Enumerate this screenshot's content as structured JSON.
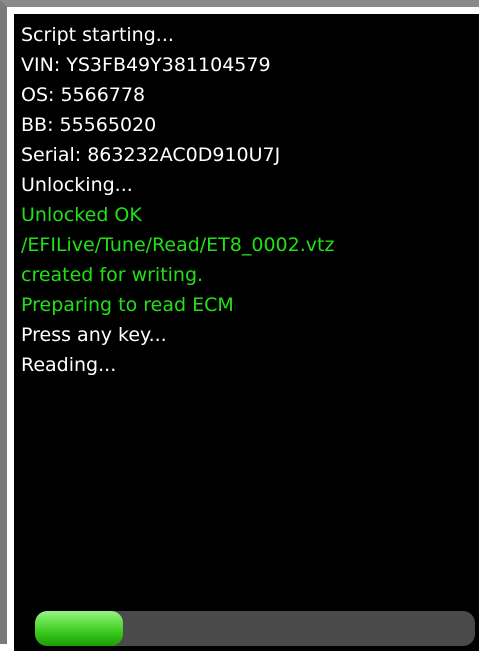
{
  "colors": {
    "white_text": "#ffffff",
    "green_text": "#22e016",
    "background": "#000000"
  },
  "log": {
    "lines": [
      {
        "text": "Script starting...",
        "color": "#ffffff"
      },
      {
        "text": "VIN: YS3FB49Y381104579",
        "color": "#ffffff"
      },
      {
        "text": "OS: 5566778",
        "color": "#ffffff"
      },
      {
        "text": "BB: 55565020",
        "color": "#ffffff"
      },
      {
        "text": "Serial: 863232AC0D910U7J",
        "color": "#ffffff"
      },
      {
        "text": "Unlocking...",
        "color": "#ffffff"
      },
      {
        "text": "Unlocked OK",
        "color": "#22e016"
      },
      {
        "text": "/EFILive/Tune/Read/ET8_0002.vtz",
        "color": "#22e016"
      },
      {
        "text": "created for writing.",
        "color": "#22e016"
      },
      {
        "text": "Preparing to read ECM",
        "color": "#22e016"
      },
      {
        "text": "Press any key...",
        "color": "#ffffff"
      },
      {
        "text": "Reading...",
        "color": "#ffffff"
      }
    ]
  },
  "progress": {
    "fraction": 0.2
  }
}
